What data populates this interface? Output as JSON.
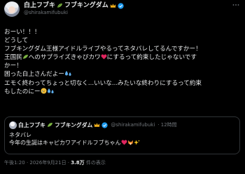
{
  "author": {
    "name": "白上フブキ",
    "name_suffix": "フブキングダム",
    "handle": "@shirakamifubuki"
  },
  "tweet": {
    "lines": [
      "おーい！！！",
      "どうして",
      "フブキングダム王様アイドルライブやるってネタバレしてるんですかー！",
      "王国民",
      "へのサプライズきゃぴカワ",
      "にするって約束したじゃないです",
      "かー！",
      "困った白上さんだよー",
      "エモく終わってちょっと切なく...いいな...みたいな終わりにするって約束",
      "もしたのにー"
    ]
  },
  "quote": {
    "name": "白上フブキ",
    "name_suffix": "フブキングダム",
    "handle": "@shirakamifubuki",
    "time": "· 12時間",
    "lines": [
      "ネタバレ",
      "今年の生誕はキャピカワアイドルフブちゃん"
    ]
  },
  "meta": {
    "time": "午後1:20 · 2026年9月21日 · ",
    "views": "3.8万",
    "views_label": " 件の表示"
  },
  "icons": {
    "verified": "verified-badge-icon",
    "more": "more-icon",
    "heart_color": "#e0245e",
    "leaf_color": "#7cb342",
    "crown_color": "#f5b21b"
  }
}
